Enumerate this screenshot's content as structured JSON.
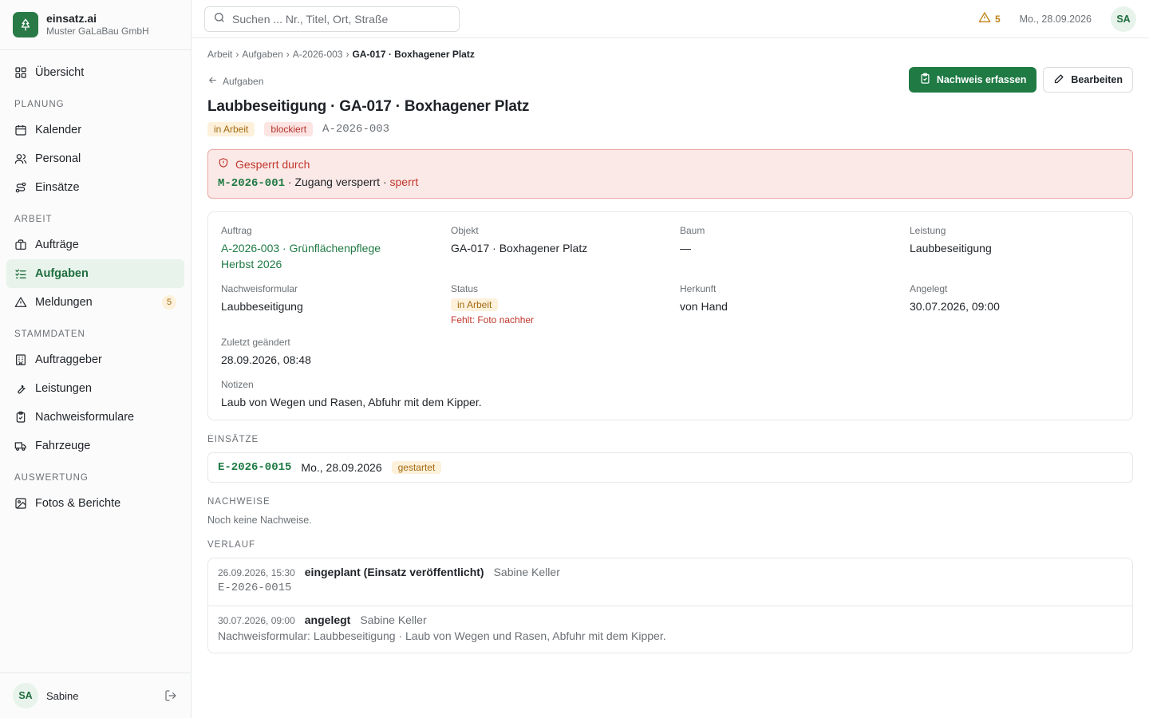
{
  "brand": {
    "name": "einsatz.ai",
    "company": "Muster GaLaBau GmbH"
  },
  "sidebar": {
    "overview": {
      "label": "Übersicht",
      "icon": "grid-icon"
    },
    "sections": [
      {
        "title": "PLANUNG",
        "items": [
          {
            "label": "Kalender",
            "icon": "calendar-icon"
          },
          {
            "label": "Personal",
            "icon": "users-icon"
          },
          {
            "label": "Einsätze",
            "icon": "route-icon"
          }
        ]
      },
      {
        "title": "ARBEIT",
        "items": [
          {
            "label": "Aufträge",
            "icon": "briefcase-icon"
          },
          {
            "label": "Aufgaben",
            "icon": "checklist-icon",
            "active": true
          },
          {
            "label": "Meldungen",
            "icon": "warning-icon",
            "badge": "5"
          }
        ]
      },
      {
        "title": "STAMMDATEN",
        "items": [
          {
            "label": "Auftraggeber",
            "icon": "building-icon"
          },
          {
            "label": "Leistungen",
            "icon": "wrench-icon"
          },
          {
            "label": "Nachweisformulare",
            "icon": "clipboard-icon"
          },
          {
            "label": "Fahrzeuge",
            "icon": "truck-icon"
          }
        ]
      },
      {
        "title": "AUSWERTUNG",
        "items": [
          {
            "label": "Fotos & Berichte",
            "icon": "image-icon"
          }
        ]
      }
    ],
    "footer": {
      "initials": "SA",
      "name": "Sabine"
    }
  },
  "topbar": {
    "search_placeholder": "Suchen ... Nr., Titel, Ort, Straße",
    "alert_count": "5",
    "date": "Mo., 28.09.2026",
    "initials": "SA"
  },
  "breadcrumb": {
    "items": [
      "Arbeit",
      "Aufgaben",
      "A-2026-003"
    ],
    "current": "GA-017 · Boxhagener Platz"
  },
  "page": {
    "back_label": "Aufgaben",
    "title": "Laubbeseitigung · GA-017 · Boxhagener Platz",
    "status_tag": "in Arbeit",
    "blocked_tag": "blockiert",
    "code": "A-2026-003",
    "btn_primary": "Nachweis erfassen",
    "btn_secondary": "Bearbeiten"
  },
  "blocked": {
    "title": "Gesperrt durch",
    "code": "M-2026-001",
    "reason": " · Zugang versperrt · ",
    "state": "sperrt"
  },
  "details": {
    "auftrag_label": "Auftrag",
    "auftrag_value": "A-2026-003 · Grünflächenpflege Herbst 2026",
    "objekt_label": "Objekt",
    "objekt_value": "GA-017 · Boxhagener Platz",
    "baum_label": "Baum",
    "baum_value": "—",
    "leistung_label": "Leistung",
    "leistung_value": "Laubbeseitigung",
    "formular_label": "Nachweisformular",
    "formular_value": "Laubbeseitigung",
    "status_label": "Status",
    "status_value": "in Arbeit",
    "status_missing": "Fehlt: Foto nachher",
    "herkunft_label": "Herkunft",
    "herkunft_value": "von Hand",
    "angelegt_label": "Angelegt",
    "angelegt_value": "30.07.2026, 09:00",
    "geaendert_label": "Zuletzt geändert",
    "geaendert_value": "28.09.2026, 08:48",
    "notizen_label": "Notizen",
    "notizen_value": "Laub von Wegen und Rasen, Abfuhr mit dem Kipper."
  },
  "einsaetze": {
    "title": "EINSÄTZE",
    "rows": [
      {
        "code": "E-2026-0015",
        "date": "Mo., 28.09.2026",
        "status": "gestartet"
      }
    ]
  },
  "nachweise": {
    "title": "NACHWEISE",
    "empty": "Noch keine Nachweise."
  },
  "verlauf": {
    "title": "VERLAUF",
    "entries": [
      {
        "time": "26.09.2026, 15:30",
        "event": "eingeplant (Einsatz veröffentlicht)",
        "user": "Sabine Keller",
        "detail": "E-2026-0015"
      },
      {
        "time": "30.07.2026, 09:00",
        "event": "angelegt",
        "user": "Sabine Keller",
        "detail": "Nachweisformular: Laubbeseitigung · Laub von Wegen und Rasen, Abfuhr mit dem Kipper."
      }
    ]
  },
  "colors": {
    "accent": "#1f7a44",
    "danger": "#c0362c",
    "warning": "#a36a12"
  }
}
